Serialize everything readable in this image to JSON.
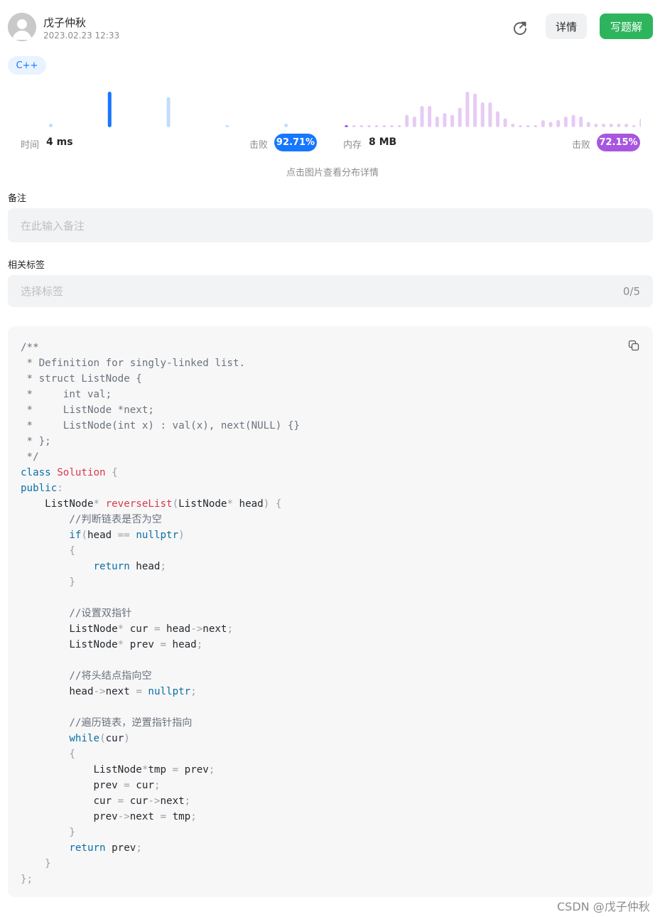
{
  "user": {
    "name": "戊子仲秋",
    "date": "2023.02.23 12:33"
  },
  "header": {
    "detail_label": "详情",
    "write_label": "写题解"
  },
  "tag": {
    "language": "C++"
  },
  "colors": {
    "accent_blue": "#1677ff",
    "accent_purple": "#a856e0",
    "green": "#2db55d"
  },
  "stats": {
    "time_label": "时间",
    "time_value": "4 ms",
    "memory_label": "内存",
    "memory_value": "8 MB",
    "beat_label": "击败",
    "time_beat": "92.71%",
    "memory_beat": "72.15%",
    "hint": "点击图片查看分布详情"
  },
  "chart_data": [
    {
      "type": "bar",
      "title": "",
      "series": [
        {
          "values": [
            2,
            0,
            0,
            20,
            0,
            0,
            17,
            0,
            0,
            1,
            0,
            0,
            2
          ]
        }
      ],
      "highlight_index": 3
    },
    {
      "type": "bar",
      "title": "",
      "series": [
        {
          "values": [
            1,
            1,
            1,
            1,
            1,
            1,
            1,
            1,
            7,
            6,
            12,
            12,
            6,
            8,
            7,
            11,
            20,
            19,
            14,
            14,
            9,
            5,
            2,
            1,
            1,
            1,
            4,
            3,
            4,
            6,
            7,
            6,
            3,
            2,
            2,
            2,
            2,
            2,
            1,
            5
          ]
        }
      ],
      "highlight_index": 0
    }
  ],
  "notes": {
    "label": "备注",
    "placeholder": "在此输入备注"
  },
  "tags": {
    "label": "相关标签",
    "placeholder": "选择标签",
    "count": "0/5"
  },
  "watermark": "CSDN @戊子仲秋"
}
